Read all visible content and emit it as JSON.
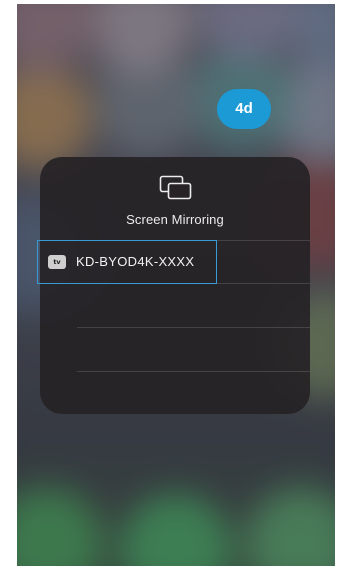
{
  "panel": {
    "title": "Screen Mirroring",
    "icon": "screen-mirroring-icon"
  },
  "devices": [
    {
      "badge": "tv",
      "badge_icon": "apple-tv-icon",
      "name": "KD-BYOD4K-XXXX"
    }
  ],
  "callout": {
    "label": "4d",
    "color": "#1b9ad6"
  },
  "colors": {
    "highlight": "#3a9ad6",
    "panel_bg": "#262226"
  }
}
